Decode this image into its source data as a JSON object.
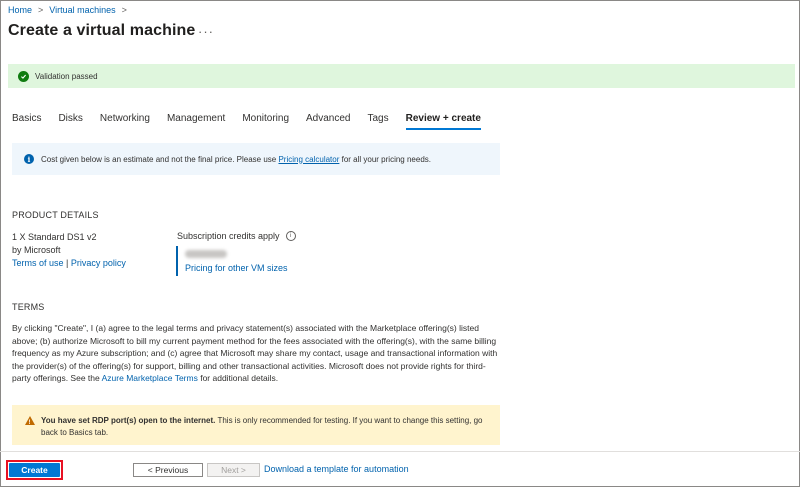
{
  "breadcrumb": {
    "home": "Home",
    "sep": ">",
    "vms": "Virtual machines"
  },
  "page": {
    "title": "Create a virtual machine",
    "more": "···"
  },
  "validation": {
    "text": "Validation passed",
    "color": "#107c10"
  },
  "tabs": [
    {
      "label": "Basics"
    },
    {
      "label": "Disks"
    },
    {
      "label": "Networking"
    },
    {
      "label": "Management"
    },
    {
      "label": "Monitoring"
    },
    {
      "label": "Advanced"
    },
    {
      "label": "Tags"
    },
    {
      "label": "Review + create",
      "active": true
    }
  ],
  "info_banner": {
    "pre": "Cost given below is an estimate and not the final price. Please use ",
    "link": "Pricing calculator",
    "post": " for all your pricing needs."
  },
  "product": {
    "heading": "PRODUCT DETAILS",
    "name": "1 X Standard DS1 v2",
    "by": "by Microsoft",
    "terms_link": "Terms of use",
    "bar": " | ",
    "privacy_link": "Privacy policy",
    "credits_label": "Subscription credits apply",
    "pricing_link": "Pricing for other VM sizes"
  },
  "terms": {
    "heading": "TERMS",
    "body": "By clicking \"Create\", I (a) agree to the legal terms and privacy statement(s) associated with the Marketplace offering(s) listed above; (b) authorize Microsoft to bill my current payment method for the fees associated with the offering(s), with the same billing frequency as my Azure subscription; and (c) agree that Microsoft may share my contact, usage and transactional information with the provider(s) of the offering(s) for support, billing and other transactional activities. Microsoft does not provide rights for third-party offerings. See the ",
    "link": "Azure Marketplace Terms",
    "tail": " for additional details."
  },
  "warning": {
    "bold": "You have set RDP port(s) open to the internet.",
    "text": "  This is only recommended for testing.  If you want to change this setting, go back to Basics tab."
  },
  "footer": {
    "create": "Create",
    "previous": "< Previous",
    "next": "Next >",
    "download": "Download a template for automation"
  },
  "colors": {
    "accent": "#0078d4",
    "link": "#0062ad",
    "success_bg": "#dff6dd",
    "warning_bg": "#fff4ce",
    "info_bg": "#eff6fc",
    "highlight": "#e81123"
  }
}
